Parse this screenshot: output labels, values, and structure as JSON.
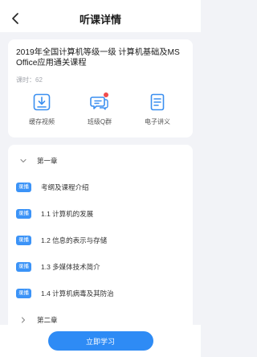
{
  "nav": {
    "title": "听课详情",
    "back_icon": "back-arrow-icon"
  },
  "course": {
    "title": "2019年全国计算机等级一级 计算机基础及MS Office应用通关课程",
    "lessons_text": "课时：62"
  },
  "actions": [
    {
      "label": "缓存视频",
      "icon": "download-icon"
    },
    {
      "label": "班级Q群",
      "icon": "chat-group-icon"
    },
    {
      "label": "电子讲义",
      "icon": "document-icon"
    }
  ],
  "chapters": [
    {
      "label": "第一章",
      "expanded": true,
      "lessons": [
        {
          "badge": "录播",
          "title": "考纲及课程介绍"
        },
        {
          "badge": "录播",
          "title": "1.1 计算机的发展"
        },
        {
          "badge": "录播",
          "title": "1.2 信息的表示与存储"
        },
        {
          "badge": "录播",
          "title": "1.3 多媒体技术简介"
        },
        {
          "badge": "录播",
          "title": "1.4 计算机病毒及其防治"
        }
      ]
    },
    {
      "label": "第二章",
      "expanded": false,
      "lessons": []
    }
  ],
  "bottom": {
    "button_label": "立即学习"
  },
  "colors": {
    "accent": "#2e8bf5",
    "badge": "#3b93f7",
    "notification_dot": "#f04b4b",
    "background": "#f2f3f7"
  }
}
